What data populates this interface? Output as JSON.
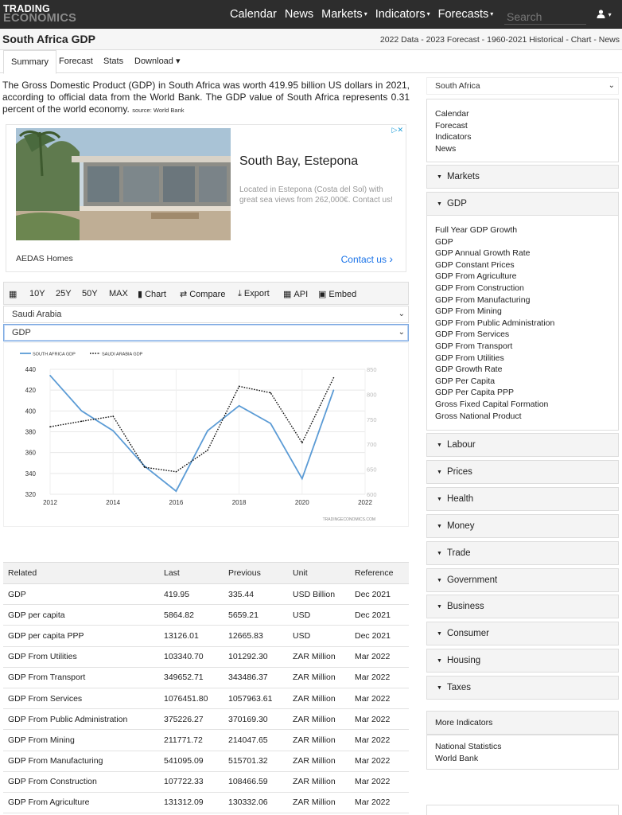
{
  "nav": {
    "logo_line1": "TRADING",
    "logo_line2": "ECONOMICS",
    "items": [
      {
        "label": "Calendar",
        "dropdown": false
      },
      {
        "label": "News",
        "dropdown": false
      },
      {
        "label": "Markets",
        "dropdown": true
      },
      {
        "label": "Indicators",
        "dropdown": true
      },
      {
        "label": "Forecasts",
        "dropdown": true
      }
    ],
    "search_placeholder": "Search",
    "user_icon": "user-icon"
  },
  "header": {
    "title": "South Africa GDP",
    "breadcrumbs": "2022 Data - 2023 Forecast - 1960-2021 Historical - Chart - News"
  },
  "tabs": [
    {
      "label": "Summary",
      "active": true
    },
    {
      "label": "Forecast",
      "active": false
    },
    {
      "label": "Stats",
      "active": false
    },
    {
      "label": "Download ▾",
      "active": false
    }
  ],
  "intro": {
    "text": "The Gross Domestic Product (GDP) in South Africa was worth 419.95 billion US dollars in 2021, according to official data from the World Bank. The GDP value of South Africa represents 0.31 percent of the world economy.",
    "source": "source: World Bank"
  },
  "ad": {
    "title": "South Bay, Estepona",
    "description": "Located in Estepona (Costa del Sol) with great sea views from 262,000€. Contact us!",
    "brand": "AEDAS Homes",
    "cta": "Contact us"
  },
  "toolbar": {
    "calendar_icon": "calendar-icon",
    "ranges": [
      "10Y",
      "25Y",
      "50Y",
      "MAX"
    ],
    "chart": "Chart",
    "compare": "Compare",
    "export": "Export",
    "api": "API",
    "embed": "Embed"
  },
  "compare_country": "Saudi Arabia",
  "compare_indicator": "GDP",
  "chart_data": {
    "type": "line",
    "x": [
      2012,
      2013,
      2014,
      2015,
      2016,
      2017,
      2018,
      2019,
      2020,
      2021
    ],
    "series": [
      {
        "name": "SOUTH AFRICA GDP",
        "axis": "left",
        "color": "#5b9bd5",
        "values": [
          434,
          400,
          381,
          347,
          323,
          381,
          405,
          388,
          335,
          420
        ]
      },
      {
        "name": "SAUDI ARABIA GDP",
        "axis": "right",
        "color": "#111111",
        "values": [
          735,
          746,
          756,
          654,
          645,
          688,
          816,
          803,
          703,
          833
        ]
      }
    ],
    "x_ticks": [
      "2012",
      "2014",
      "2016",
      "2018",
      "2020",
      "2022"
    ],
    "xlim": [
      2012,
      2022
    ],
    "y_left_ticks": [
      "320",
      "340",
      "360",
      "380",
      "400",
      "420",
      "440"
    ],
    "ylim_left": [
      320,
      440
    ],
    "y_right_ticks": [
      "600",
      "650",
      "700",
      "750",
      "800",
      "850"
    ],
    "ylim_right": [
      600,
      850
    ],
    "grid": true,
    "legend": "top-left",
    "watermark": "TRADINGECONOMICS.COM"
  },
  "related": {
    "headers": [
      "Related",
      "Last",
      "Previous",
      "Unit",
      "Reference"
    ],
    "rows": [
      [
        "GDP",
        "419.95",
        "335.44",
        "USD Billion",
        "Dec 2021"
      ],
      [
        "GDP per capita",
        "5864.82",
        "5659.21",
        "USD",
        "Dec 2021"
      ],
      [
        "GDP per capita PPP",
        "13126.01",
        "12665.83",
        "USD",
        "Dec 2021"
      ],
      [
        "GDP From Utilities",
        "103340.70",
        "101292.30",
        "ZAR Million",
        "Mar 2022"
      ],
      [
        "GDP From Transport",
        "349652.71",
        "343486.37",
        "ZAR Million",
        "Mar 2022"
      ],
      [
        "GDP From Services",
        "1076451.80",
        "1057963.61",
        "ZAR Million",
        "Mar 2022"
      ],
      [
        "GDP From Public Administration",
        "375226.27",
        "370169.30",
        "ZAR Million",
        "Mar 2022"
      ],
      [
        "GDP From Mining",
        "211771.72",
        "214047.65",
        "ZAR Million",
        "Mar 2022"
      ],
      [
        "GDP From Manufacturing",
        "541095.09",
        "515701.32",
        "ZAR Million",
        "Mar 2022"
      ],
      [
        "GDP From Construction",
        "107722.33",
        "108466.59",
        "ZAR Million",
        "Mar 2022"
      ],
      [
        "GDP From Agriculture",
        "131312.09",
        "130332.06",
        "ZAR Million",
        "Mar 2022"
      ]
    ]
  },
  "sidebar": {
    "country": "South Africa",
    "quick_links": [
      "Calendar",
      "Forecast",
      "Indicators",
      "News"
    ],
    "markets": "Markets",
    "gdp": "GDP",
    "gdp_items": [
      "Full Year GDP Growth",
      "GDP",
      "GDP Annual Growth Rate",
      "GDP Constant Prices",
      "GDP From Agriculture",
      "GDP From Construction",
      "GDP From Manufacturing",
      "GDP From Mining",
      "GDP From Public Administration",
      "GDP From Services",
      "GDP From Transport",
      "GDP From Utilities",
      "GDP Growth Rate",
      "GDP Per Capita",
      "GDP Per Capita PPP",
      "Gross Fixed Capital Formation",
      "Gross National Product"
    ],
    "categories": [
      "Labour",
      "Prices",
      "Health",
      "Money",
      "Trade",
      "Government",
      "Business",
      "Consumer",
      "Housing",
      "Taxes"
    ],
    "more_title": "More Indicators",
    "more_links": [
      "National Statistics",
      "World Bank"
    ]
  }
}
